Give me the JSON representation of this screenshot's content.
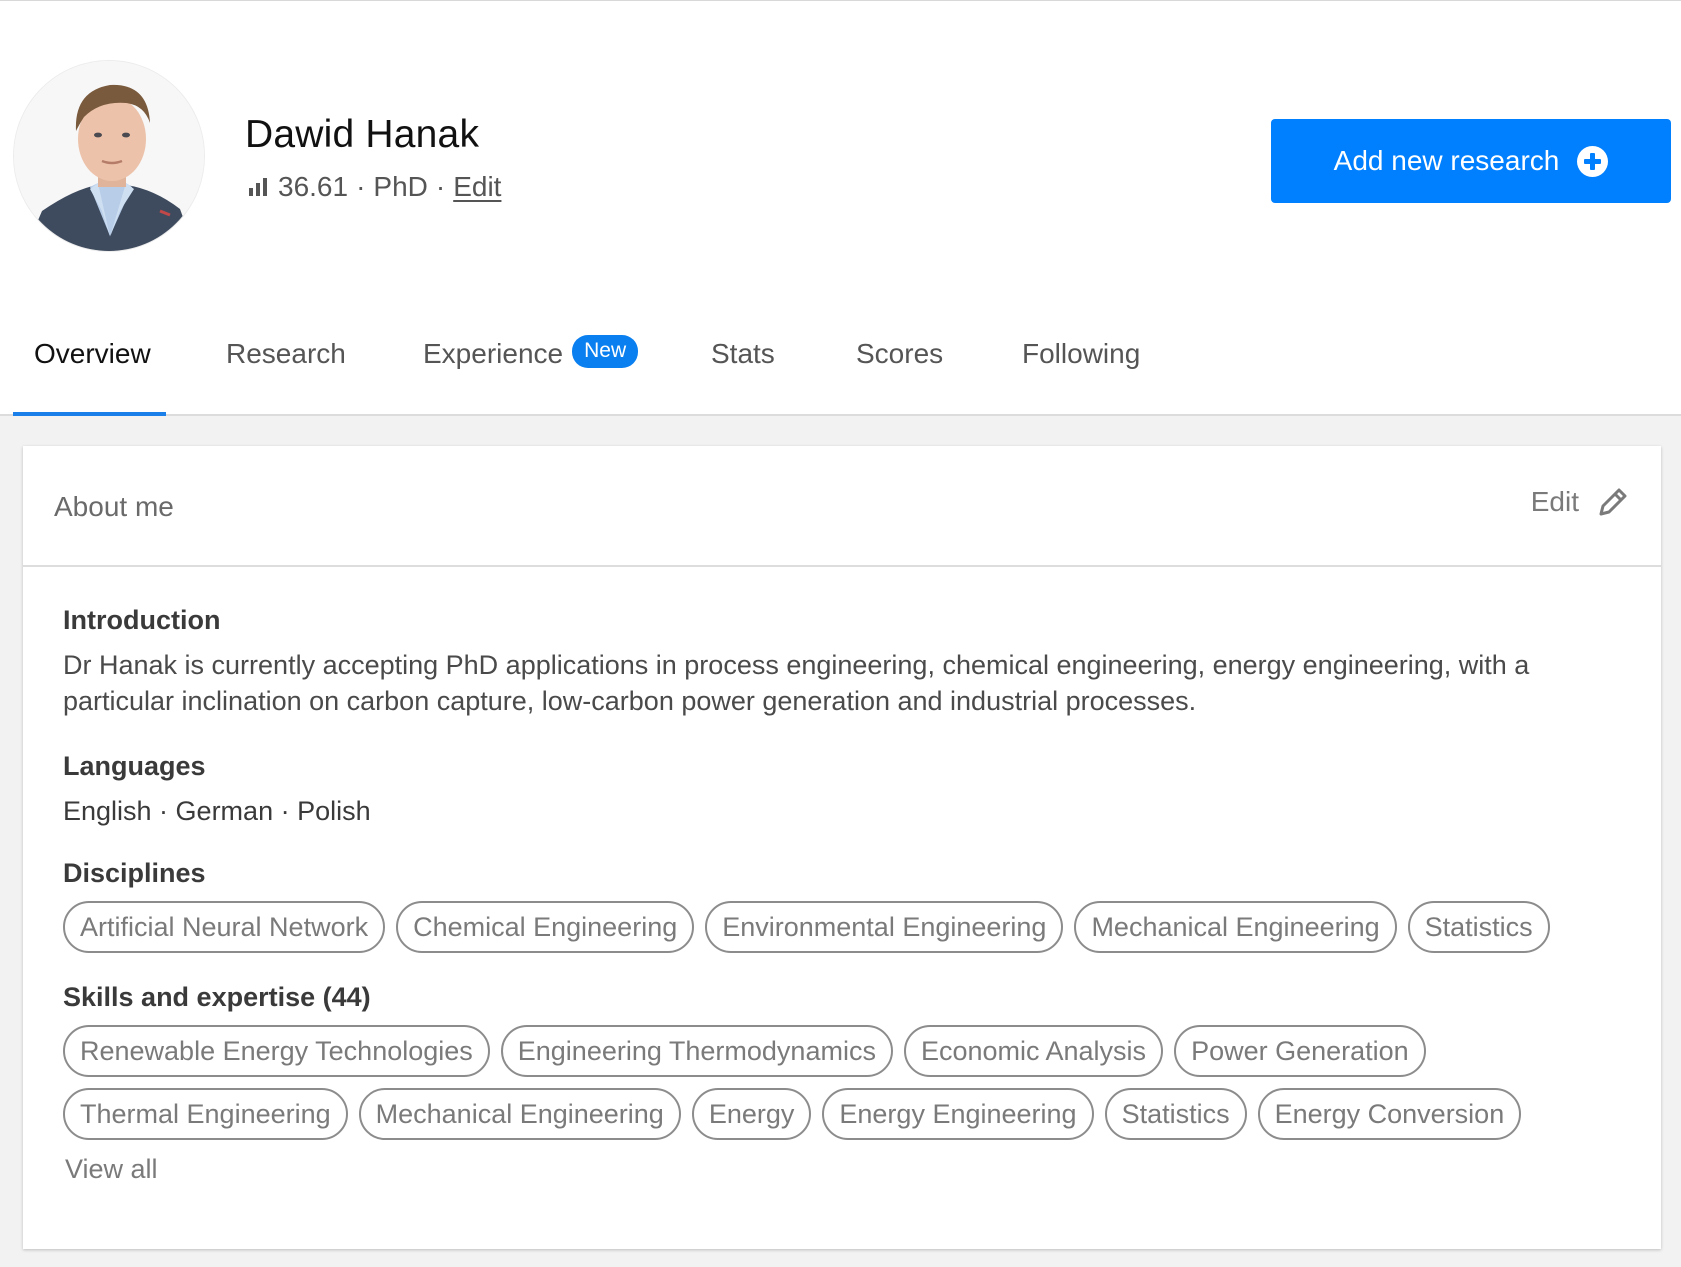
{
  "profile": {
    "name": "Dawid Hanak",
    "score": "36.61",
    "separator": "·",
    "degree": "PhD",
    "edit_label": "Edit",
    "avatar_alt": "Profile photo of Dawid Hanak"
  },
  "actions": {
    "add_research_label": "Add new research"
  },
  "tabs": [
    {
      "label": "Overview",
      "active": true
    },
    {
      "label": "Research"
    },
    {
      "label": "Experience",
      "badge": "New"
    },
    {
      "label": "Stats"
    },
    {
      "label": "Scores"
    },
    {
      "label": "Following"
    }
  ],
  "about": {
    "title": "About me",
    "edit_label": "Edit",
    "introduction": {
      "heading": "Introduction",
      "text": "Dr Hanak is currently accepting PhD applications in process engineering, chemical engineering, energy engineering, with a particular inclination on carbon capture, low-carbon power generation and industrial processes."
    },
    "languages": {
      "heading": "Languages",
      "text": "English · German · Polish"
    },
    "disciplines": {
      "heading": "Disciplines",
      "items": [
        "Artificial Neural Network",
        "Chemical Engineering",
        "Environmental Engineering",
        "Mechanical Engineering",
        "Statistics"
      ]
    },
    "skills": {
      "heading": "Skills and expertise (44)",
      "items": [
        "Renewable Energy Technologies",
        "Engineering Thermodynamics",
        "Economic Analysis",
        "Power Generation",
        "Thermal Engineering",
        "Mechanical Engineering",
        "Energy",
        "Energy Engineering",
        "Statistics",
        "Energy Conversion"
      ],
      "view_all_label": "View all"
    }
  },
  "colors": {
    "accent": "#0080ff",
    "tab_underline": "#1a7fe8",
    "chip_border": "#8c8c8c",
    "page_bg": "#f2f2f2"
  },
  "icons": {
    "score": "bar-chart-icon",
    "add": "plus-circle-icon",
    "edit": "pencil-icon"
  }
}
